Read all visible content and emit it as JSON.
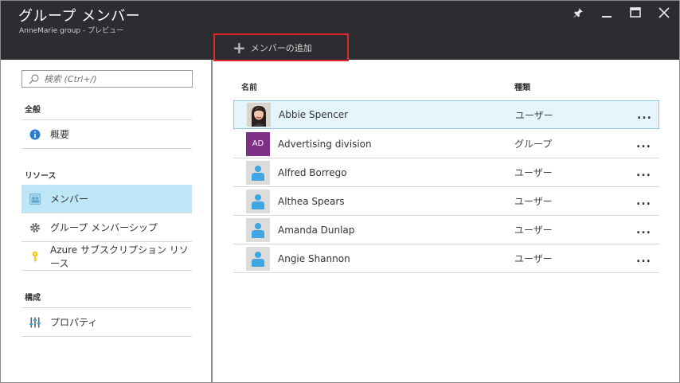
{
  "header": {
    "title": "グループ メンバー",
    "subtitle": "AnneMarie group - プレビュー",
    "add_member_label": "メンバーの追加",
    "controls": [
      "pin-icon",
      "minimize-icon",
      "maximize-icon",
      "close-icon"
    ]
  },
  "sidebar": {
    "search_placeholder": "検索 (Ctrl+/)",
    "sections": [
      {
        "heading": "全般"
      },
      {
        "heading": "リソース"
      },
      {
        "heading": "構成"
      }
    ],
    "items": [
      {
        "label": "概要",
        "icon": "info-icon"
      },
      {
        "label": "メンバー",
        "icon": "members-icon",
        "active": true
      },
      {
        "label": "グループ メンバーシップ",
        "icon": "gear-icon"
      },
      {
        "label": "Azure サブスクリプション リソース",
        "icon": "key-icon"
      },
      {
        "label": "プロパティ",
        "icon": "properties-icon"
      }
    ]
  },
  "table": {
    "headers": {
      "name": "名前",
      "type": "種類"
    },
    "rows": [
      {
        "name": "Abbie Spencer",
        "type": "ユーザー",
        "avatar": "photo",
        "more": "...",
        "selected": true
      },
      {
        "name": "Advertising division",
        "type": "グループ",
        "avatar": "AD",
        "more": "..."
      },
      {
        "name": "Alfred Borrego",
        "type": "ユーザー",
        "avatar": "user",
        "more": "..."
      },
      {
        "name": "Althea Spears",
        "type": "ユーザー",
        "avatar": "user",
        "more": "..."
      },
      {
        "name": "Amanda Dunlap",
        "type": "ユーザー",
        "avatar": "user",
        "more": "..."
      },
      {
        "name": "Angie Shannon",
        "type": "ユーザー",
        "avatar": "user",
        "more": "..."
      }
    ]
  },
  "colors": {
    "header_bg": "#2b2d30",
    "highlight_border": "#e0262c",
    "active_nav": "#bde7f6",
    "selected_row": "#e6f5fc",
    "group_avatar": "#7e2f86",
    "user_icon": "#3ea6e0"
  }
}
